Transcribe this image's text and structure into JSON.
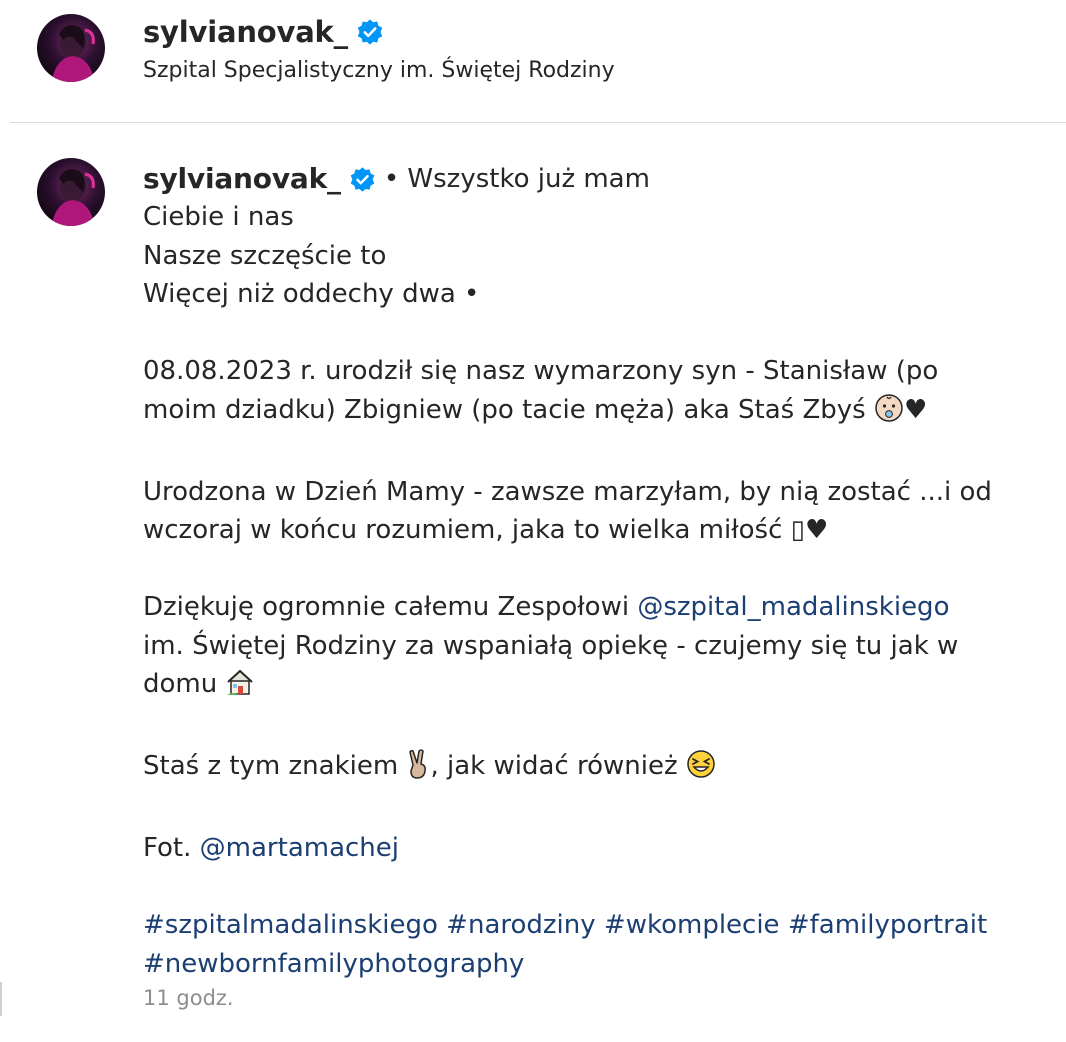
{
  "header": {
    "username": "sylvianovak_",
    "location": "Szpital Specjalistyczny im. Świętej Rodziny"
  },
  "comment": {
    "username": "sylvianovak_",
    "lines": {
      "l1": "• Wszystko już mam",
      "l2": "Ciebie i nas",
      "l3": "Nasze szczęście to",
      "l4": "Więcej niż oddechy dwa •",
      "l5": "08.08.2023 r. urodził się nasz wymarzony syn - Stanisław (po",
      "l6": "moim dziadku) Zbigniew (po tacie męża) aka Staś Zbyś",
      "l6_heart": "♥",
      "l7": "Urodzona w Dzień Mamy - zawsze marzyłam, by nią zostać ...i od",
      "l8": "wczoraj w końcu rozumiem, jaka to wielka miłość ▯♥",
      "l9_a": "Dziękuję ogromnie całemu Zespołowi ",
      "l9_mention": "@szpital_madalinskiego",
      "l10": "im. Świętej Rodziny za wspaniałą opiekę - czujemy się tu jak w",
      "l11": "domu",
      "l12_a": "Staś z tym znakiem",
      "l12_b": ", jak widać również",
      "l13_a": "Fot. ",
      "l13_mention": "@martamachej",
      "hashtags_1": "#szpitalmadalinskiego #narodziny #wkomplecie #familyportrait",
      "hashtags_2": "#newbornfamilyphotography"
    },
    "timestamp": "11 godz."
  },
  "icons": {
    "verified": "verified-badge-icon",
    "baby": "baby-emoji-icon",
    "house": "house-emoji-icon",
    "victory": "victory-hand-emoji-icon",
    "laugh": "grinning-squinting-emoji-icon"
  },
  "colors": {
    "text": "#262626",
    "link": "#1c3f73",
    "muted": "#8e8e8e",
    "verified": "#0095f6",
    "divider": "#dbdbdb"
  }
}
